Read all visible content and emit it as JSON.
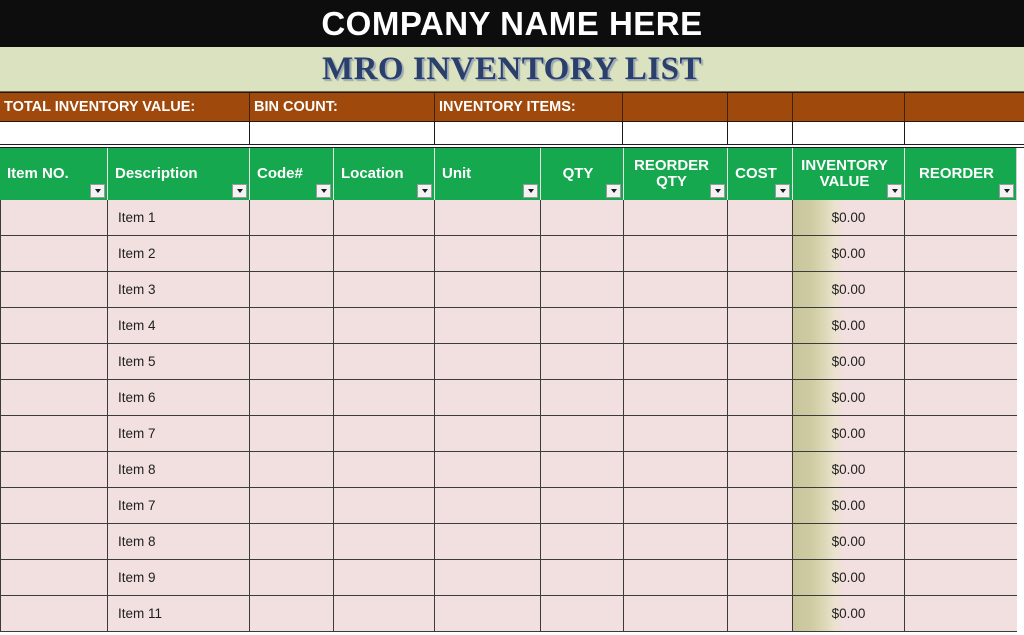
{
  "banner": {
    "company_name": "COMPANY NAME HERE",
    "sheet_title": "MRO INVENTORY LIST"
  },
  "colors": {
    "banner_black": "#0d0d0d",
    "title_sage": "#dbe2bf",
    "title_navy": "#2b3f6b",
    "summary_brown": "#a0490d",
    "header_green": "#16a84f",
    "row_pink": "#f2dfdf",
    "databar_olive": "#c9c59b"
  },
  "summary": {
    "labels": [
      "TOTAL INVENTORY VALUE:",
      "BIN COUNT:",
      "INVENTORY ITEMS:",
      "",
      "",
      "",
      ""
    ],
    "values": [
      "",
      "",
      "",
      "",
      "",
      "",
      ""
    ]
  },
  "table": {
    "columns": [
      {
        "label": "Item NO.",
        "align": "left",
        "filter": true,
        "filter_mark": false
      },
      {
        "label": "Description",
        "align": "left",
        "filter": true,
        "filter_mark": true
      },
      {
        "label": "Code#",
        "align": "left",
        "filter": true,
        "filter_mark": false
      },
      {
        "label": "Location",
        "align": "left",
        "filter": true,
        "filter_mark": false
      },
      {
        "label": "Unit",
        "align": "left",
        "filter": true,
        "filter_mark": false
      },
      {
        "label": "QTY",
        "align": "center",
        "filter": true,
        "filter_mark": false
      },
      {
        "label": "REORDER QTY",
        "align": "center",
        "filter": true,
        "filter_mark": false
      },
      {
        "label": "COST",
        "align": "center",
        "filter": true,
        "filter_mark": false
      },
      {
        "label": "INVENTORY VALUE",
        "align": "center",
        "filter": true,
        "filter_mark": false
      },
      {
        "label": "REORDER",
        "align": "center",
        "filter": true,
        "filter_mark": false
      }
    ],
    "rows": [
      {
        "item_no": "",
        "description": "Item 1",
        "code": "",
        "location": "",
        "unit": "",
        "qty": "",
        "reorder_qty": "",
        "cost": "",
        "inventory_value": "$0.00",
        "reorder": ""
      },
      {
        "item_no": "",
        "description": "Item 2",
        "code": "",
        "location": "",
        "unit": "",
        "qty": "",
        "reorder_qty": "",
        "cost": "",
        "inventory_value": "$0.00",
        "reorder": ""
      },
      {
        "item_no": "",
        "description": "Item 3",
        "code": "",
        "location": "",
        "unit": "",
        "qty": "",
        "reorder_qty": "",
        "cost": "",
        "inventory_value": "$0.00",
        "reorder": ""
      },
      {
        "item_no": "",
        "description": "Item 4",
        "code": "",
        "location": "",
        "unit": "",
        "qty": "",
        "reorder_qty": "",
        "cost": "",
        "inventory_value": "$0.00",
        "reorder": ""
      },
      {
        "item_no": "",
        "description": "Item 5",
        "code": "",
        "location": "",
        "unit": "",
        "qty": "",
        "reorder_qty": "",
        "cost": "",
        "inventory_value": "$0.00",
        "reorder": ""
      },
      {
        "item_no": "",
        "description": "Item 6",
        "code": "",
        "location": "",
        "unit": "",
        "qty": "",
        "reorder_qty": "",
        "cost": "",
        "inventory_value": "$0.00",
        "reorder": ""
      },
      {
        "item_no": "",
        "description": "Item 7",
        "code": "",
        "location": "",
        "unit": "",
        "qty": "",
        "reorder_qty": "",
        "cost": "",
        "inventory_value": "$0.00",
        "reorder": ""
      },
      {
        "item_no": "",
        "description": "Item 8",
        "code": "",
        "location": "",
        "unit": "",
        "qty": "",
        "reorder_qty": "",
        "cost": "",
        "inventory_value": "$0.00",
        "reorder": ""
      },
      {
        "item_no": "",
        "description": "Item 7",
        "code": "",
        "location": "",
        "unit": "",
        "qty": "",
        "reorder_qty": "",
        "cost": "",
        "inventory_value": "$0.00",
        "reorder": ""
      },
      {
        "item_no": "",
        "description": "Item 8",
        "code": "",
        "location": "",
        "unit": "",
        "qty": "",
        "reorder_qty": "",
        "cost": "",
        "inventory_value": "$0.00",
        "reorder": ""
      },
      {
        "item_no": "",
        "description": "Item 9",
        "code": "",
        "location": "",
        "unit": "",
        "qty": "",
        "reorder_qty": "",
        "cost": "",
        "inventory_value": "$0.00",
        "reorder": ""
      },
      {
        "item_no": "",
        "description": "Item 11",
        "code": "",
        "location": "",
        "unit": "",
        "qty": "",
        "reorder_qty": "",
        "cost": "",
        "inventory_value": "$0.00",
        "reorder": ""
      }
    ]
  }
}
